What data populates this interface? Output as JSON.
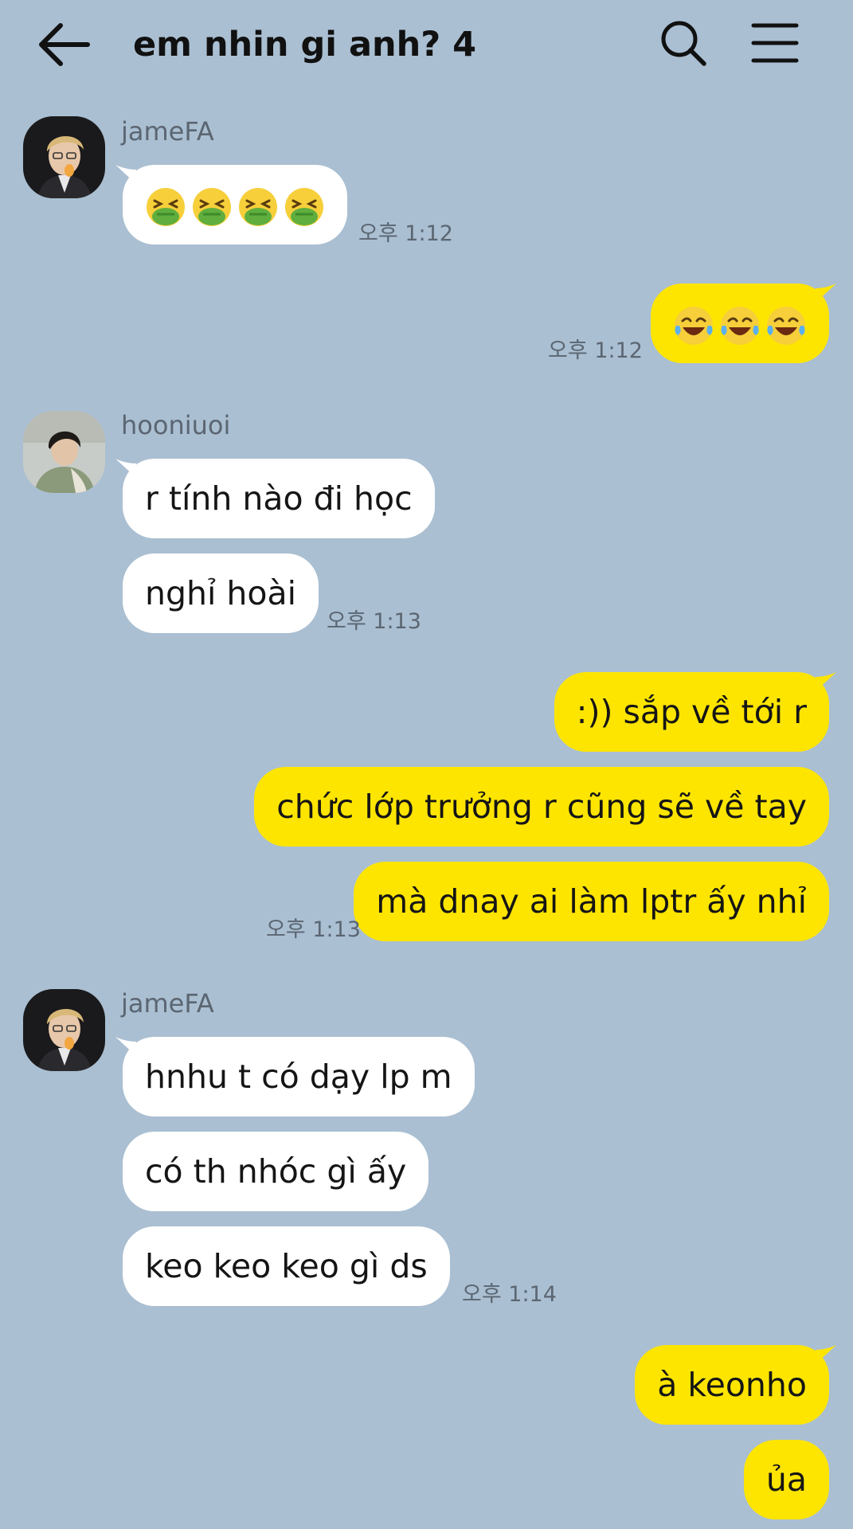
{
  "header": {
    "title": "em nhin gi anh? 4",
    "back_icon": "arrow-left-icon",
    "search_icon": "search-icon",
    "menu_icon": "hamburger-menu-icon"
  },
  "colors": {
    "background": "#aabfd2",
    "incoming_bubble": "#ffffff",
    "outgoing_bubble": "#fee500",
    "meta_text": "#5b6672"
  },
  "messages": [
    {
      "direction": "in",
      "sender": "jameFA",
      "emojis": [
        "nauseated-face",
        "nauseated-face",
        "nauseated-face",
        "nauseated-face"
      ],
      "time": "오후 1:12"
    },
    {
      "direction": "out",
      "emojis": [
        "tears-of-joy-face",
        "tears-of-joy-face",
        "tears-of-joy-face"
      ],
      "time": "오후 1:12"
    },
    {
      "direction": "in",
      "sender": "hooniuoi",
      "texts": [
        "r tính nào đi học",
        "nghỉ hoài"
      ],
      "time": "오후 1:13"
    },
    {
      "direction": "out",
      "texts": [
        ":)) sắp về tới r",
        "chức lớp trưởng r cũng sẽ về tay",
        "mà dnay ai làm lptr ấy nhỉ"
      ],
      "time": "오후 1:13"
    },
    {
      "direction": "in",
      "sender": "jameFA",
      "texts": [
        "hnhu t có dạy lp m",
        "có th nhóc gì ấy",
        "keo keo keo gì ds"
      ],
      "time": "오후 1:14"
    },
    {
      "direction": "out",
      "texts": [
        "à keonho",
        "ủa"
      ]
    }
  ]
}
